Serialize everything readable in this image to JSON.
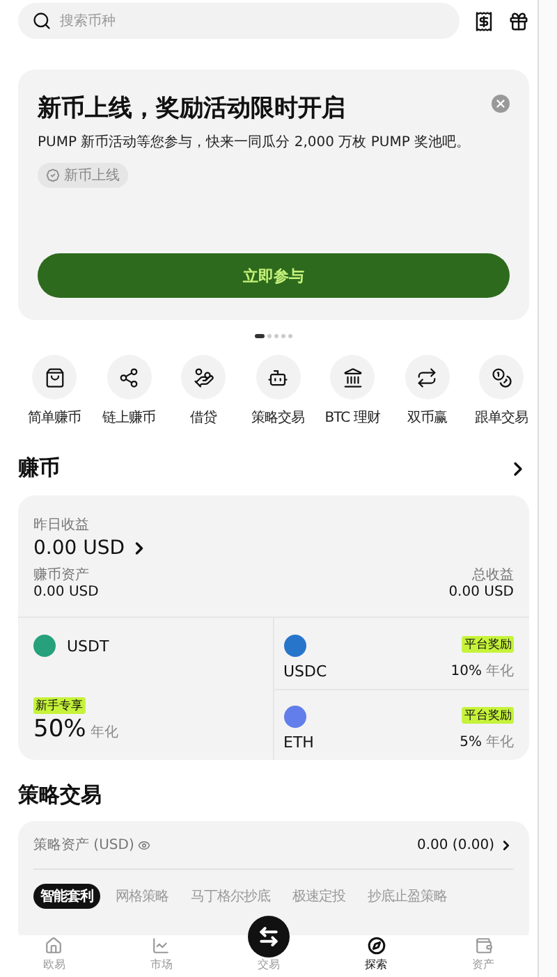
{
  "search": {
    "placeholder": "搜索币种"
  },
  "banner": {
    "title": "新币上线，奖励活动限时开启",
    "text": "PUMP 新币活动等您参与，快来一同瓜分 2,000 万枚 PUMP 奖池吧。",
    "tag": "新币上线",
    "button": "立即参与",
    "pages": [
      {
        "selected": true
      },
      {
        "selected": false
      },
      {
        "selected": false
      },
      {
        "selected": false
      },
      {
        "selected": false
      }
    ]
  },
  "shortcuts": [
    {
      "label": "简单赚币",
      "kind": "bag"
    },
    {
      "label": "链上赚币",
      "kind": "nodes"
    },
    {
      "label": "借贷",
      "kind": "hand"
    },
    {
      "label": "策略交易",
      "kind": "robot"
    },
    {
      "label": "BTC 理财",
      "kind": "safe"
    },
    {
      "label": "双币赢",
      "kind": "swap"
    },
    {
      "label": "跟单交易",
      "kind": "coins"
    }
  ],
  "earn": {
    "title": "赚币",
    "yesterday_label": "昨日收益",
    "yesterday_value": "0.00 USD",
    "assets_label": "赚币资产",
    "assets_value": "0.00 USD",
    "total_label": "总收益",
    "total_value": "0.00 USD",
    "featured": {
      "coin": "USDT",
      "color": "#26a17b",
      "badge": "新手专享",
      "rate": "50%",
      "rate_unit": "年化"
    },
    "coins": [
      {
        "coin": "USDC",
        "color": "#2775ca",
        "badge": "平台奖励",
        "rate": "10%",
        "rate_unit": "年化"
      },
      {
        "coin": "ETH",
        "color": "#627eea",
        "badge": "平台奖励",
        "rate": "5%",
        "rate_unit": "年化"
      }
    ]
  },
  "strategy": {
    "title": "策略交易",
    "assets_label": "策略资产 (USD)",
    "assets_value": "0.00 (0.00)",
    "tabs": [
      {
        "label": "智能套利",
        "selected": true
      },
      {
        "label": "网格策略",
        "selected": false
      },
      {
        "label": "马丁格尔抄底",
        "selected": false
      },
      {
        "label": "极速定投",
        "selected": false
      },
      {
        "label": "抄底止盈策略",
        "selected": false
      }
    ]
  },
  "nav": [
    {
      "label": "欧易",
      "kind": "home",
      "selected": false
    },
    {
      "label": "市场",
      "kind": "chart",
      "selected": false
    },
    {
      "label": "交易",
      "kind": "trade",
      "selected": false
    },
    {
      "label": "探索",
      "kind": "explore",
      "selected": true
    },
    {
      "label": "资产",
      "kind": "wallet",
      "selected": false
    }
  ]
}
